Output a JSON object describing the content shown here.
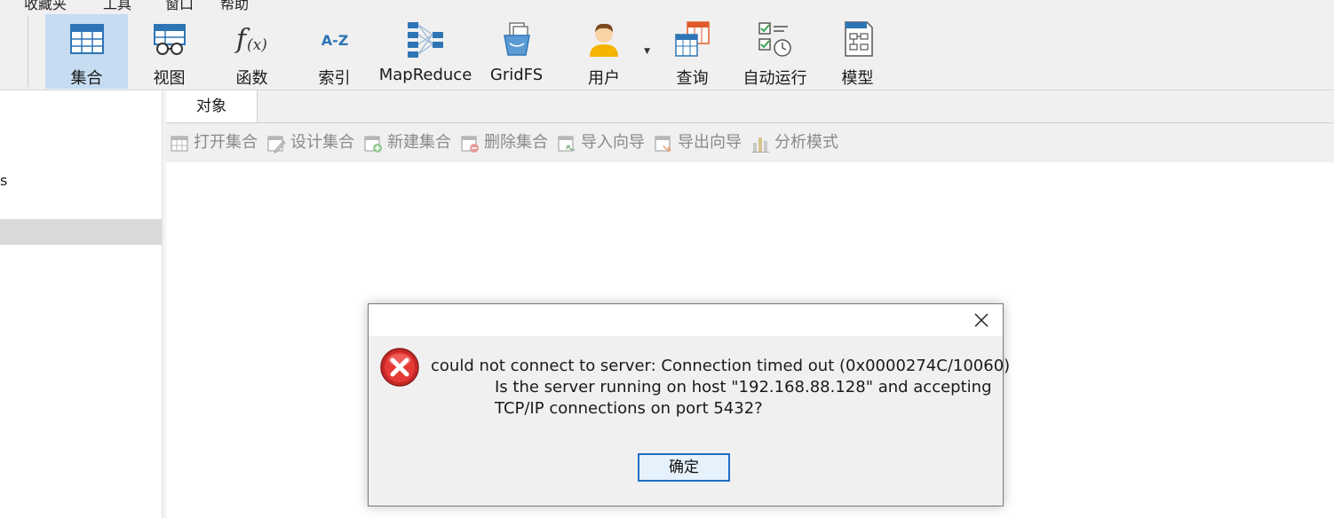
{
  "menubar": {
    "items": [
      "收藏夹",
      "工具",
      "窗口",
      "帮助"
    ]
  },
  "ribbon": {
    "buttons": [
      {
        "label": "集合",
        "icon": "table-icon",
        "active": true
      },
      {
        "label": "视图",
        "icon": "view-glasses-icon"
      },
      {
        "label": "函数",
        "icon": "function-icon"
      },
      {
        "label": "索引",
        "icon": "sort-az-icon",
        "glyph": "A-Z"
      },
      {
        "label": "MapReduce",
        "icon": "mapreduce-icon"
      },
      {
        "label": "GridFS",
        "icon": "gridfs-bucket-icon"
      },
      {
        "label": "用户",
        "icon": "user-icon"
      },
      {
        "label": "查询",
        "icon": "query-icon"
      },
      {
        "label": "自动运行",
        "icon": "schedule-icon"
      },
      {
        "label": "模型",
        "icon": "model-icon"
      }
    ],
    "accent": "#2e75b6",
    "active_bg": "#c5dcf1"
  },
  "leftpanel": {
    "partial_item": "s"
  },
  "tabs": [
    {
      "label": "对象"
    }
  ],
  "object_toolbar": {
    "items": [
      {
        "label": "打开集合",
        "icon": "open-table-icon"
      },
      {
        "label": "设计集合",
        "icon": "design-table-icon"
      },
      {
        "label": "新建集合",
        "icon": "new-table-icon"
      },
      {
        "label": "删除集合",
        "icon": "delete-table-icon"
      },
      {
        "label": "导入向导",
        "icon": "import-icon"
      },
      {
        "label": "导出向导",
        "icon": "export-icon"
      },
      {
        "label": "分析模式",
        "icon": "analyze-icon"
      }
    ]
  },
  "dialog": {
    "message_line1": "could not connect to server: Connection timed out (0x0000274C/10060)",
    "message_line2": "Is the server running on host \"192.168.88.128\" and accepting",
    "message_line3": "TCP/IP connections on port 5432?",
    "ok_label": "确定",
    "error_color": "#d32f2f"
  }
}
